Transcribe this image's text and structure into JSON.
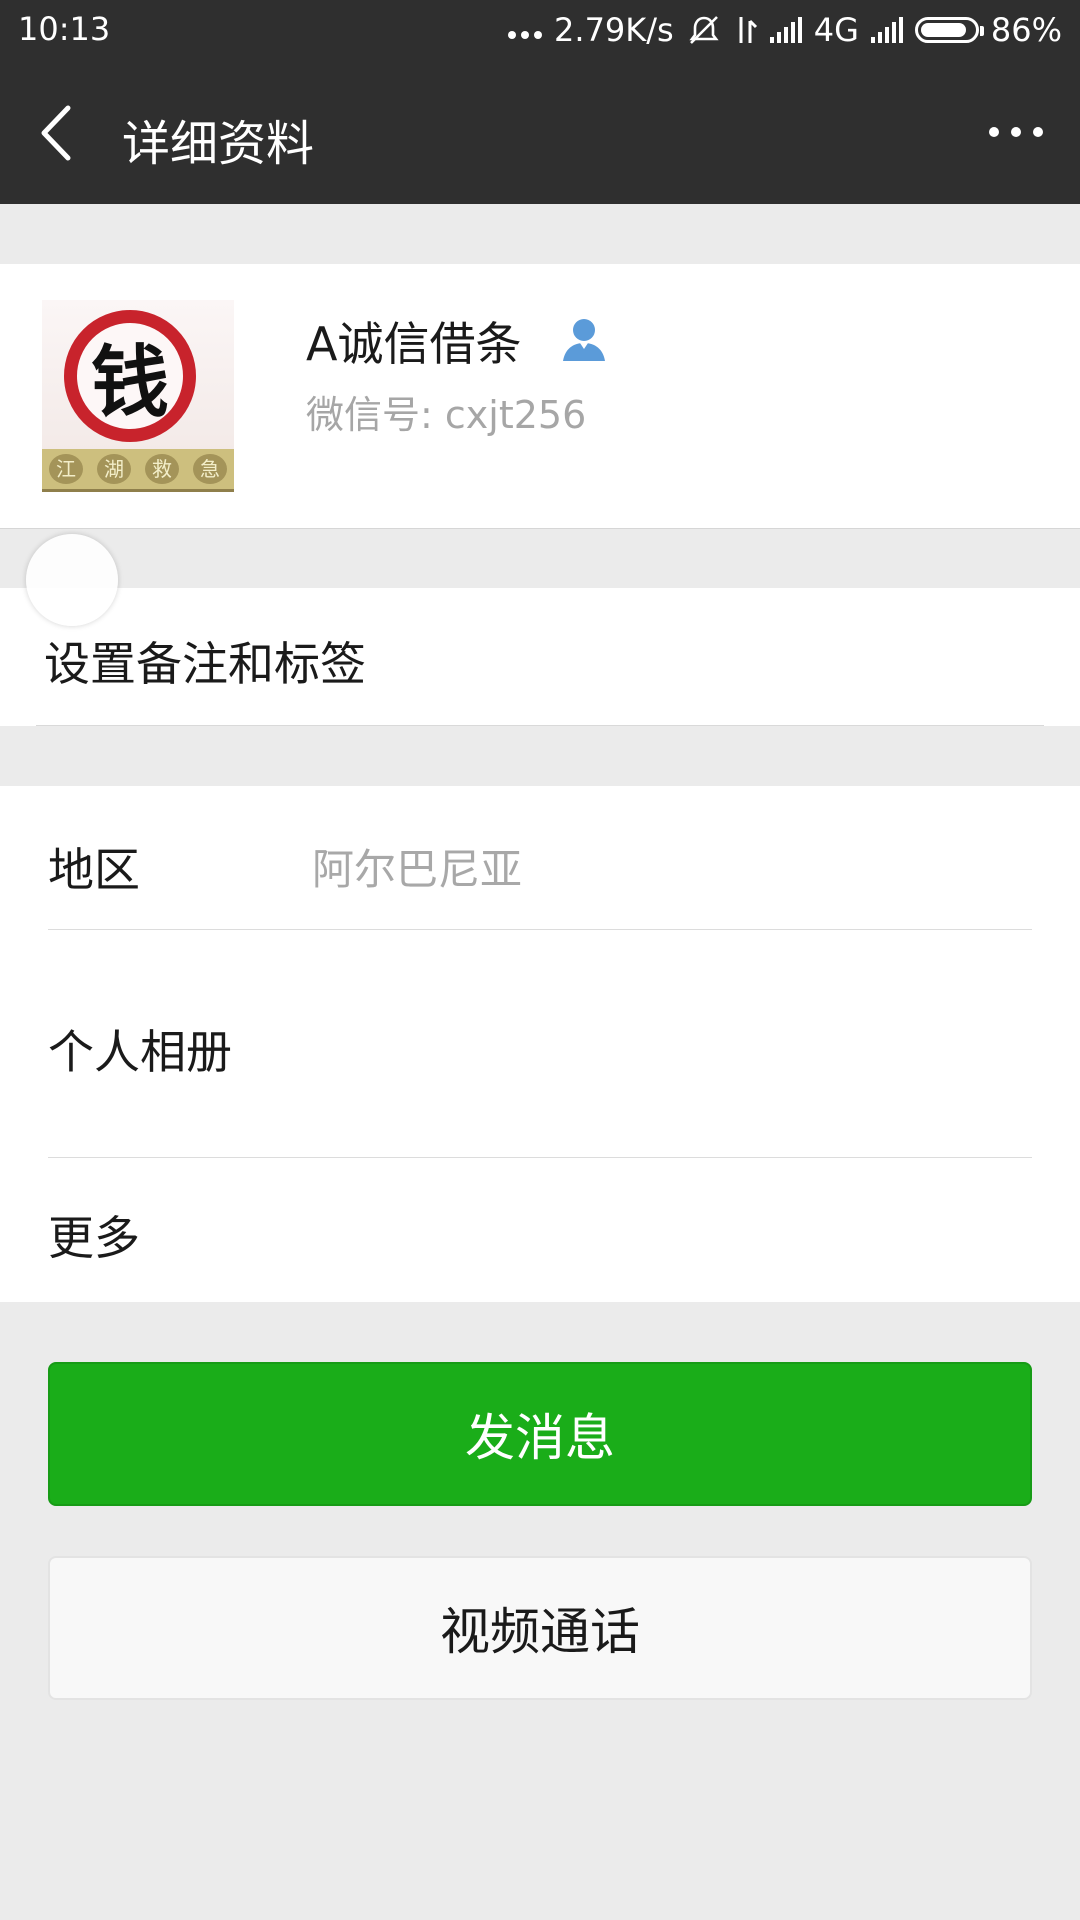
{
  "status_bar": {
    "time": "10:13",
    "net_speed": "2.79K/s",
    "network": "4G",
    "battery": "86%",
    "battery_level": 0.86,
    "icons": [
      "more-dots-icon",
      "mute-icon",
      "data-arrows-icon",
      "signal-icon",
      "battery-icon"
    ]
  },
  "header": {
    "title": "详细资料",
    "back_icon": "back-chevron-icon",
    "more_icon": "more-dots-icon"
  },
  "profile": {
    "name": "A诚信借条",
    "wechat_id": "微信号: cxjt256",
    "avatar_text": "钱",
    "avatar_strip": [
      "江",
      "湖",
      "救",
      "急"
    ],
    "badge_icon": "person-icon"
  },
  "remark": {
    "label": "设置备注和标签"
  },
  "info": {
    "region_label": "地区",
    "region_value": "阿尔巴尼亚",
    "album_label": "个人相册",
    "more_label": "更多"
  },
  "actions": {
    "send_message": "发消息",
    "video_call": "视频通话"
  },
  "colors": {
    "header_bg": "#2f2f2f",
    "page_bg": "#ebebeb",
    "primary_green": "#1aad19",
    "secondary_text": "#a8a8a8"
  }
}
